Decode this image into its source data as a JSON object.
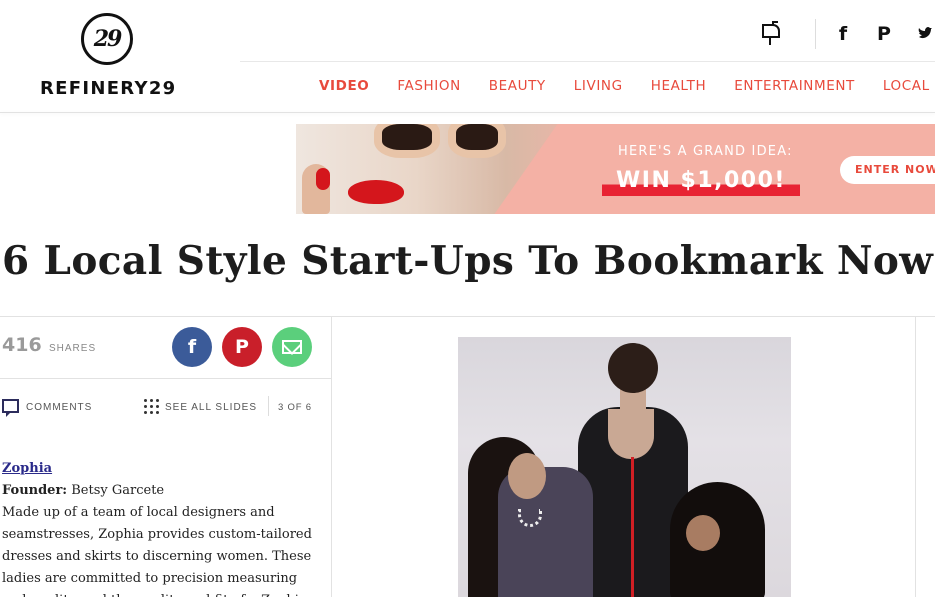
{
  "brand": {
    "logo_mark": "29",
    "wordmark": "REFINERY29"
  },
  "header_icons": [
    "mailbox-icon",
    "facebook-icon",
    "pinterest-icon",
    "twitter-icon"
  ],
  "nav": {
    "items": [
      {
        "label": "VIDEO",
        "active": true
      },
      {
        "label": "FASHION",
        "active": false
      },
      {
        "label": "BEAUTY",
        "active": false
      },
      {
        "label": "LIVING",
        "active": false
      },
      {
        "label": "HEALTH",
        "active": false
      },
      {
        "label": "ENTERTAINMENT",
        "active": false
      },
      {
        "label": "LOCAL",
        "active": false
      }
    ],
    "accent_color": "#e84a3c"
  },
  "ad": {
    "headline_small": "HERE'S A GRAND IDEA:",
    "headline_big": "WIN $1,000!",
    "cta": "ENTER NOW",
    "bg_color": "#f4b1a5"
  },
  "article": {
    "title": "6 Local Style Start-Ups To Bookmark Now",
    "shares": {
      "count": "416",
      "label": "SHARES"
    },
    "share_buttons": [
      {
        "icon": "facebook-icon",
        "glyph": "f",
        "color": "#3b5b99"
      },
      {
        "icon": "pinterest-icon",
        "glyph": "P",
        "color": "#c91f2a"
      },
      {
        "icon": "email-icon",
        "glyph": "",
        "color": "#5bcf7c"
      }
    ],
    "toolbar": {
      "comments_label": "COMMENTS",
      "see_all_label": "SEE ALL SLIDES",
      "slide_position": "3 OF 6"
    },
    "slide": {
      "brand_name": "Zophia",
      "founder_label": "Founder:",
      "founder_name": "Betsy Garcete",
      "description": "Made up of a team of local designers and seamstresses, Zophia provides custom-tailored dresses and skirts to discerning women. These ladies are committed to precision measuring and quality, and the quality and fit of a Zophia"
    }
  }
}
